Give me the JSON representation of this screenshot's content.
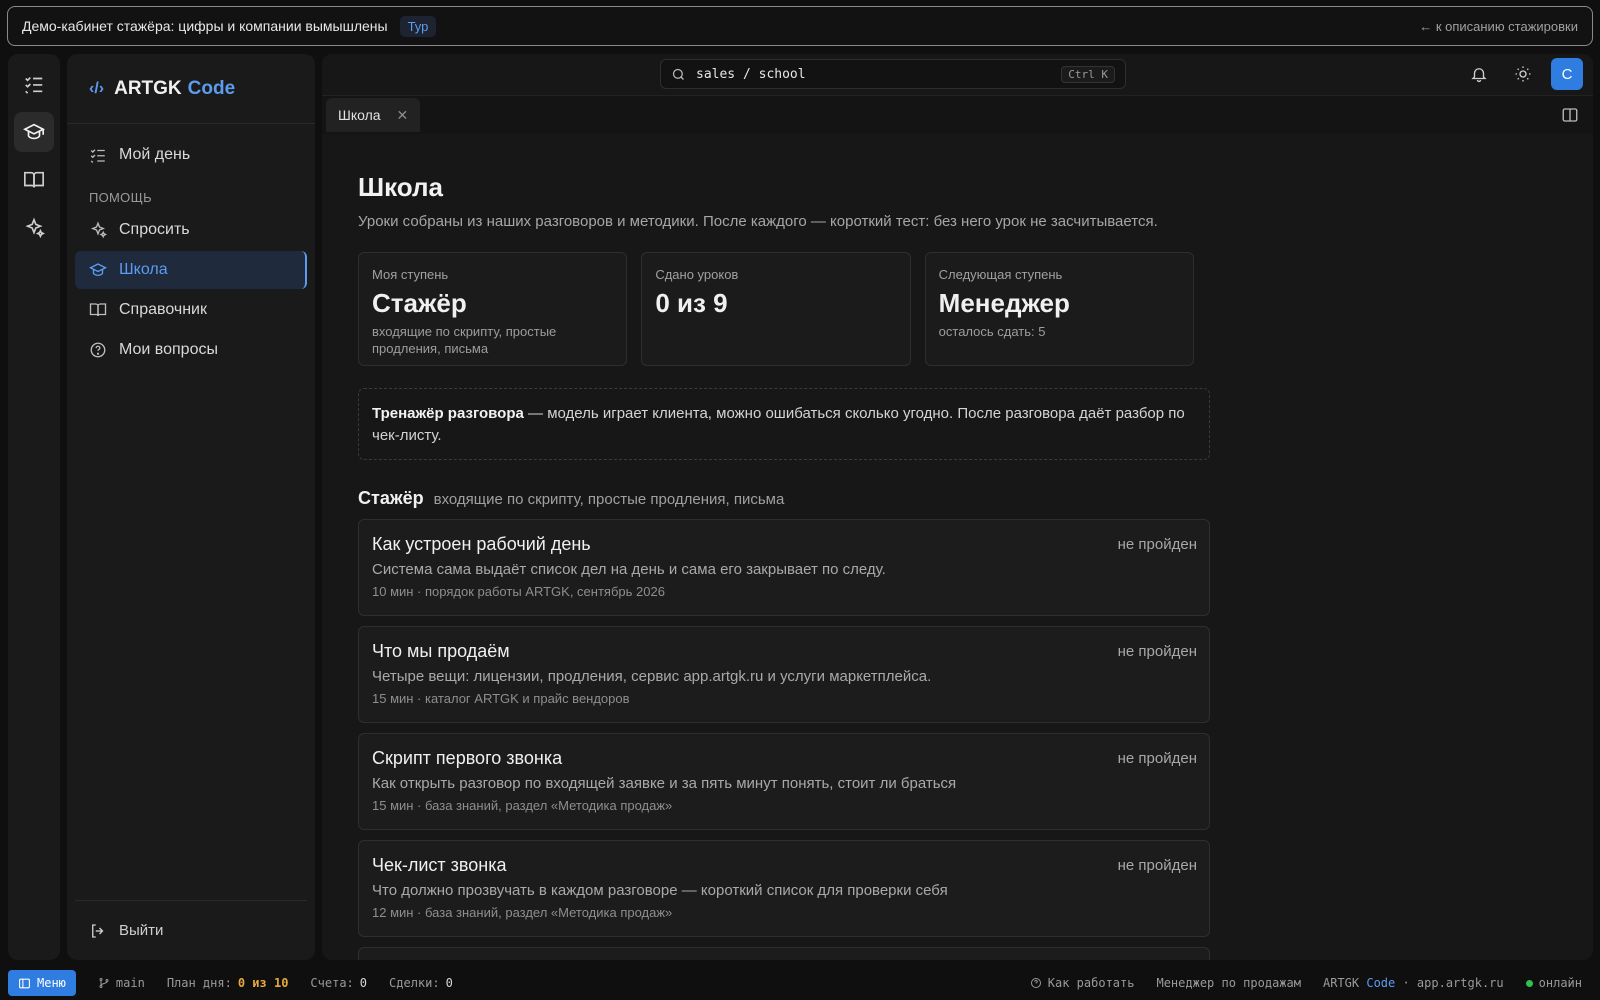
{
  "banner": {
    "text": "Демо-кабинет стажёра: цифры и компании вымышлены",
    "tour": "Тур",
    "back": "← к описанию стажировки"
  },
  "rail": {
    "items": [
      {
        "icon": "checklist-icon"
      },
      {
        "icon": "graduation-cap-icon"
      },
      {
        "icon": "book-icon"
      },
      {
        "icon": "sparkles-icon"
      }
    ]
  },
  "sidebar": {
    "brand_logo": "‹/›",
    "brand_name": "ARTGK",
    "brand_code": "Code",
    "my_day": "Мой день",
    "section_help": "ПОМОЩЬ",
    "ask": "Спросить",
    "school": "Школа",
    "reference": "Справочник",
    "my_questions": "Мои вопросы",
    "logout": "Выйти"
  },
  "topbar": {
    "search_value": "sales / school",
    "search_shortcut": "Ctrl K",
    "avatar": "С"
  },
  "tab": {
    "label": "Школа",
    "close": "✕"
  },
  "page": {
    "title": "Школа",
    "subtitle": "Уроки собраны из наших разговоров и методики. После каждого — короткий тест: без него урок не засчитывается."
  },
  "stats": [
    {
      "label": "Моя ступень",
      "value": "Стажёр",
      "note": "входящие по скрипту, простые продления, письма"
    },
    {
      "label": "Сдано уроков",
      "value": "0 из 9",
      "note": ""
    },
    {
      "label": "Следующая ступень",
      "value": "Менеджер",
      "note": "осталось сдать: 5"
    }
  ],
  "trainer": {
    "bold": "Тренажёр разговора",
    "text": " — модель играет клиента, можно ошибаться сколько угодно. После разговора даёт разбор по чек-листу."
  },
  "group": {
    "title": "Стажёр",
    "subtitle": "входящие по скрипту, простые продления, письма"
  },
  "lessons": [
    {
      "title": "Как устроен рабочий день",
      "desc": "Система сама выдаёт список дел на день и сама его закрывает по следу.",
      "meta": "10 мин · порядок работы ARTGK, сентябрь 2026",
      "status": "не пройден"
    },
    {
      "title": "Что мы продаём",
      "desc": "Четыре вещи: лицензии, продления, сервис app.artgk.ru и услуги маркетплейса.",
      "meta": "15 мин · каталог ARTGK и прайс вендоров",
      "status": "не пройден"
    },
    {
      "title": "Скрипт первого звонка",
      "desc": "Как открыть разговор по входящей заявке и за пять минут понять, стоит ли браться",
      "meta": "15 мин · база знаний, раздел «Методика продаж»",
      "status": "не пройден"
    },
    {
      "title": "Чек-лист звонка",
      "desc": "Что должно прозвучать в каждом разговоре — короткий список для проверки себя",
      "meta": "12 мин · база знаний, раздел «Методика продаж»",
      "status": "не пройден"
    }
  ],
  "statusbar": {
    "menu": "Меню",
    "branch": "main",
    "plan_label": "План дня:",
    "plan_value": "0 из 10",
    "invoices_label": "Счета:",
    "invoices_value": "0",
    "deals_label": "Сделки:",
    "deals_value": "0",
    "how_to": "Как работать",
    "role": "Менеджер по продажам",
    "brand_name": "ARTGK",
    "brand_code": "Code",
    "domain": "· app.artgk.ru",
    "online": "онлайн"
  },
  "colors": {
    "accent": "#5b9cf0",
    "avatar": "#2f7de1",
    "highlight": "#e8a93a",
    "online": "#2ec24f"
  }
}
